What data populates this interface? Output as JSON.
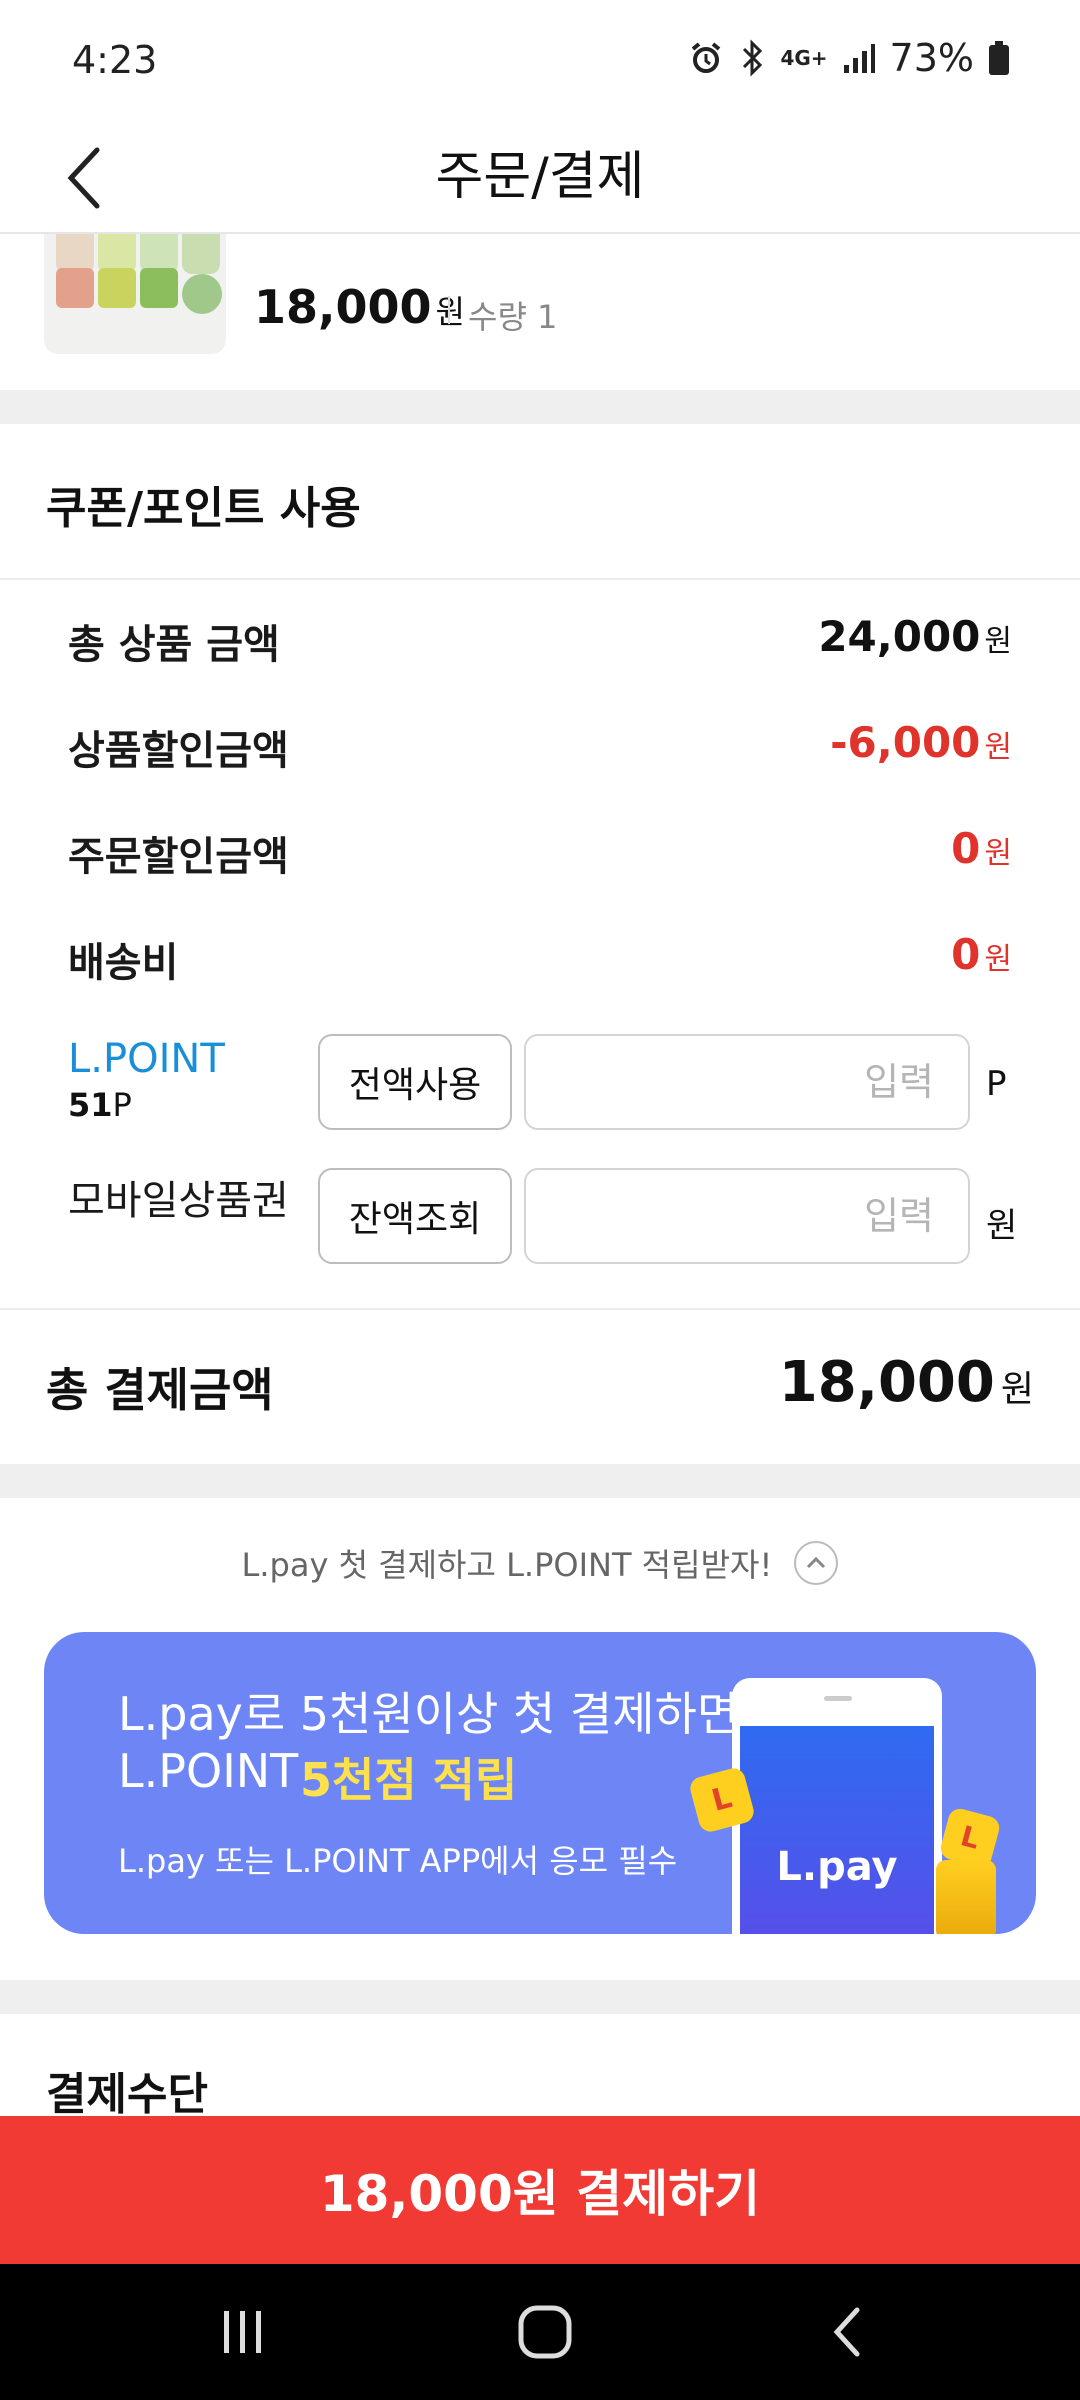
{
  "status_bar": {
    "time": "4:23",
    "network": "4G+",
    "battery": "73%"
  },
  "header": {
    "title": "주문/결제"
  },
  "product": {
    "price": "18,000",
    "currency": "원",
    "quantity": "수량 1"
  },
  "coupon_section": {
    "title": "쿠폰/포인트 사용",
    "rows": [
      {
        "label": "총 상품 금액",
        "value": "24,000",
        "unit": "원"
      },
      {
        "label": "상품할인금액",
        "value": "-6,000",
        "unit": "원"
      },
      {
        "label": "주문할인금액",
        "value": "0",
        "unit": "원"
      },
      {
        "label": "배송비",
        "value": "0",
        "unit": "원"
      }
    ],
    "lpoint": {
      "label": "L.POINT",
      "balance_value": "51",
      "balance_unit": "P",
      "button": "전액사용",
      "placeholder": "입력",
      "unit": "P"
    },
    "giftcard": {
      "label": "모바일상품권",
      "button": "잔액조회",
      "placeholder": "입력",
      "unit": "원"
    }
  },
  "total": {
    "label": "총 결제금액",
    "value": "18,000",
    "unit": "원"
  },
  "promo": {
    "text": "L.pay 첫 결제하고 L.POINT 적립받자!",
    "banner_line1": "L.pay로 5천원이상 첫 결제하면",
    "banner_line2_prefix": "L.POINT",
    "banner_line2_highlight": "5천점 적립",
    "banner_sub": "L.pay 또는 L.POINT APP에서 응모 필수",
    "phone_logo": "L.pay",
    "coin_letter": "L"
  },
  "payment": {
    "section_title": "결제수단",
    "button_label": "18,000원 결제하기"
  },
  "colors": {
    "accent_red": "#f03a33",
    "discount_red": "#e0332b",
    "lpoint_blue": "#1a8fd8",
    "banner_bg": "#6e86f5",
    "banner_highlight": "#ffe14d"
  },
  "icons": {
    "back": "chevron-left-icon",
    "promo_toggle": "chevron-up-icon",
    "nav_recents": "recents-icon",
    "nav_home": "home-icon",
    "nav_back": "back-icon"
  }
}
